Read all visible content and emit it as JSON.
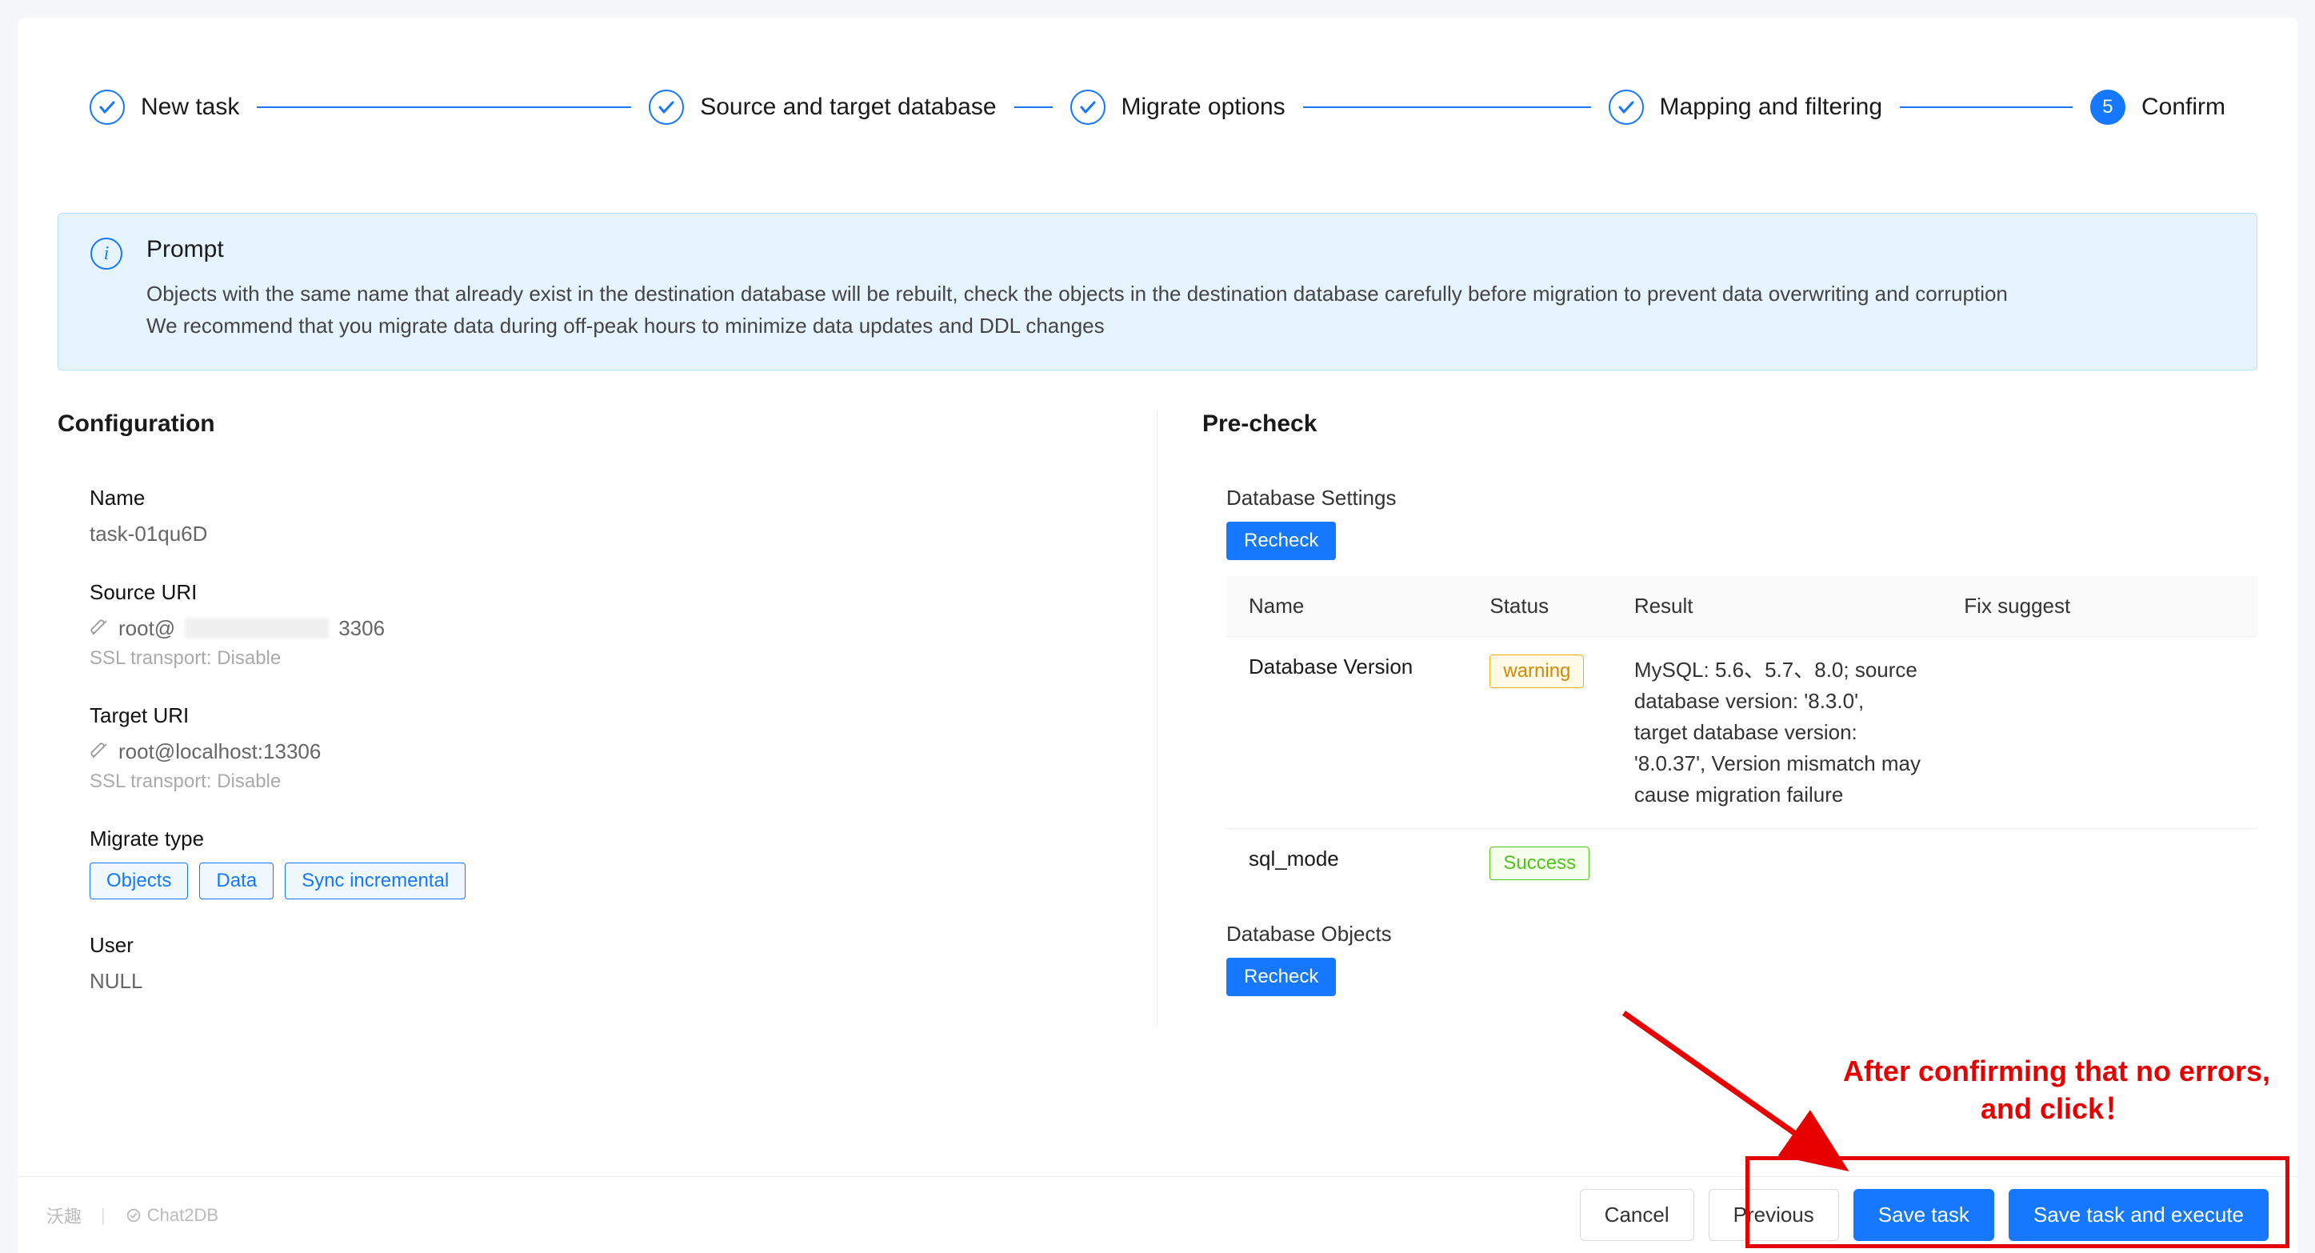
{
  "stepper": {
    "steps": [
      {
        "label": "New task",
        "done": true
      },
      {
        "label": "Source and target database",
        "done": true
      },
      {
        "label": "Migrate options",
        "done": true
      },
      {
        "label": "Mapping and filtering",
        "done": true
      },
      {
        "label": "Confirm",
        "number": "5",
        "active": true
      }
    ]
  },
  "prompt": {
    "title": "Prompt",
    "line1": "Objects with the same name that already exist in the destination database will be rebuilt, check the objects in the destination database carefully before migration to prevent data overwriting and corruption",
    "line2": "We recommend that you migrate data during off-peak hours to minimize data updates and DDL changes"
  },
  "config": {
    "title": "Configuration",
    "name_label": "Name",
    "name_value": "task-01qu6D",
    "source_label": "Source URI",
    "source_prefix": "root@",
    "source_suffix": "3306",
    "source_ssl": "SSL transport: Disable",
    "target_label": "Target URI",
    "target_value": "root@localhost:13306",
    "target_ssl": "SSL transport: Disable",
    "migrate_type_label": "Migrate type",
    "chips": [
      "Objects",
      "Data",
      "Sync incremental"
    ],
    "user_label": "User",
    "user_value": "NULL"
  },
  "precheck": {
    "title": "Pre-check",
    "settings_heading": "Database Settings",
    "recheck_label": "Recheck",
    "columns": {
      "name": "Name",
      "status": "Status",
      "result": "Result",
      "fix": "Fix suggest"
    },
    "rows": [
      {
        "name": "Database Version",
        "status": "warning",
        "status_label": "warning",
        "result": "MySQL: 5.6、5.7、8.0; source database version: '8.3.0', target database version: '8.0.37', Version mismatch may cause migration failure",
        "fix": ""
      },
      {
        "name": "sql_mode",
        "status": "success",
        "status_label": "Success",
        "result": "",
        "fix": ""
      }
    ],
    "objects_heading": "Database Objects"
  },
  "footer": {
    "brand1": "沃趣",
    "brand2": "Chat2DB",
    "cancel": "Cancel",
    "previous": "Previous",
    "save": "Save task",
    "save_exec": "Save task and execute"
  },
  "annotation": {
    "line1": "After confirming that no errors,",
    "line2": "and click！"
  }
}
